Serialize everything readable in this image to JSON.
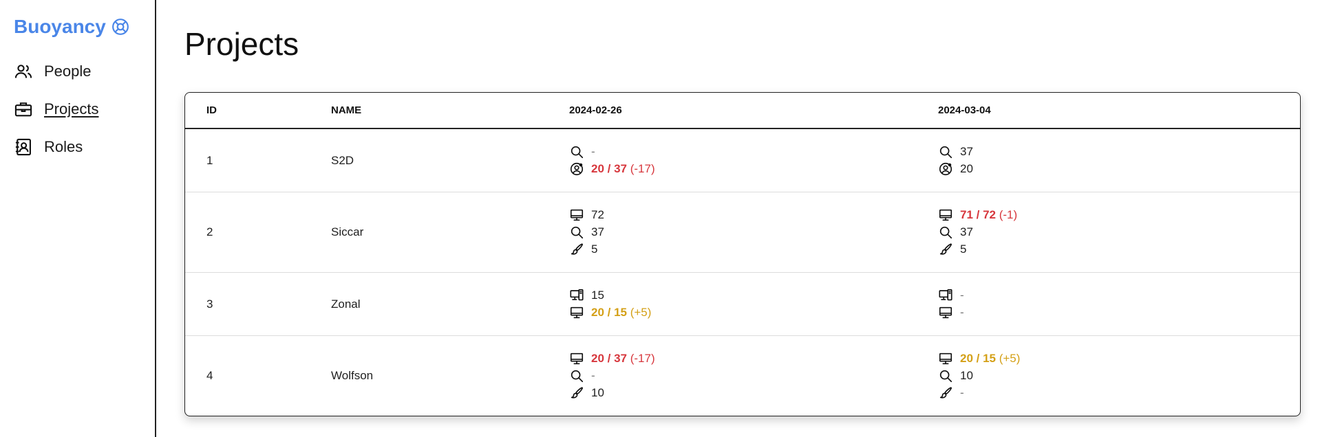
{
  "sidebar": {
    "brand": "Buoyancy",
    "items": [
      {
        "label": "People"
      },
      {
        "label": "Projects"
      },
      {
        "label": "Roles"
      }
    ]
  },
  "page": {
    "title": "Projects"
  },
  "table": {
    "headers": {
      "id": "ID",
      "name": "NAME",
      "date1": "2024-02-26",
      "date2": "2024-03-04"
    },
    "rows": [
      {
        "id": "1",
        "name": "S2D",
        "d1": [
          {
            "icon": "search-icon",
            "value": "-"
          },
          {
            "icon": "user-badge-icon",
            "main": "20 / 37",
            "delta": "(-17)",
            "status": "red"
          }
        ],
        "d2": [
          {
            "icon": "search-icon",
            "value": "37"
          },
          {
            "icon": "user-badge-icon",
            "value": "20"
          }
        ]
      },
      {
        "id": "2",
        "name": "Siccar",
        "d1": [
          {
            "icon": "monitor-icon",
            "value": "72"
          },
          {
            "icon": "search-icon",
            "value": "37"
          },
          {
            "icon": "brush-icon",
            "value": "5"
          }
        ],
        "d2": [
          {
            "icon": "monitor-icon",
            "main": "71 / 72",
            "delta": "(-1)",
            "status": "red"
          },
          {
            "icon": "search-icon",
            "value": "37"
          },
          {
            "icon": "brush-icon",
            "value": "5"
          }
        ]
      },
      {
        "id": "3",
        "name": "Zonal",
        "d1": [
          {
            "icon": "devices-icon",
            "value": "15"
          },
          {
            "icon": "monitor-icon",
            "main": "20 / 15",
            "delta": "(+5)",
            "status": "yellow"
          }
        ],
        "d2": [
          {
            "icon": "devices-icon",
            "value": "-"
          },
          {
            "icon": "monitor-icon",
            "value": "-"
          }
        ]
      },
      {
        "id": "4",
        "name": "Wolfson",
        "d1": [
          {
            "icon": "monitor-icon",
            "main": "20 / 37",
            "delta": "(-17)",
            "status": "red"
          },
          {
            "icon": "search-icon",
            "value": "-"
          },
          {
            "icon": "brush-icon",
            "value": "10"
          }
        ],
        "d2": [
          {
            "icon": "monitor-icon",
            "main": "20 / 15",
            "delta": "(+5)",
            "status": "yellow"
          },
          {
            "icon": "search-icon",
            "value": "10"
          },
          {
            "icon": "brush-icon",
            "value": "-"
          }
        ]
      }
    ]
  },
  "colors": {
    "accent": "#4a86e8",
    "red": "#d7373d",
    "yellow": "#d4a017"
  }
}
